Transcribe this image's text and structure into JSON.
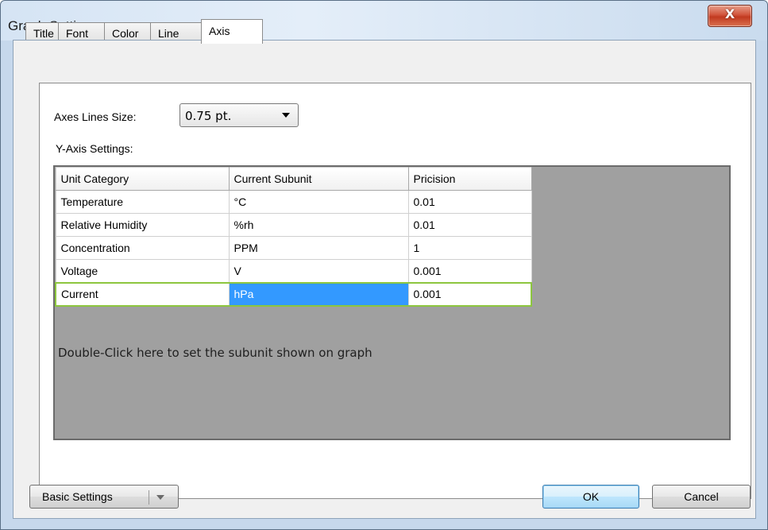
{
  "window": {
    "title": "Graph Settings",
    "close_glyph": "X"
  },
  "tabs": [
    {
      "label": "Title"
    },
    {
      "label": "Font"
    },
    {
      "label": "Color"
    },
    {
      "label": "Line"
    },
    {
      "label": "Axis"
    }
  ],
  "axis": {
    "axes_lines_size_label": "Axes Lines Size:",
    "axes_lines_size_value": "0.75 pt.",
    "y_axis_settings_label": "Y-Axis Settings:",
    "columns": [
      "Unit Category",
      "Current Subunit",
      "Pricision"
    ],
    "rows": [
      [
        "Temperature",
        "°C",
        "0.01"
      ],
      [
        "Relative Humidity",
        "%rh",
        "0.01"
      ],
      [
        "Concentration",
        "PPM",
        "1"
      ],
      [
        "Voltage",
        "V",
        "0.001"
      ],
      [
        "Current",
        "hPa",
        "0.001"
      ]
    ],
    "hint": "Double-Click here to set the subunit shown on graph"
  },
  "buttons": {
    "basic": "Basic Settings",
    "ok": "OK",
    "cancel": "Cancel"
  },
  "colors": {
    "selection": "#3399ff",
    "current_row_border": "#8dc63f",
    "grid_bg": "#a0a0a0"
  }
}
